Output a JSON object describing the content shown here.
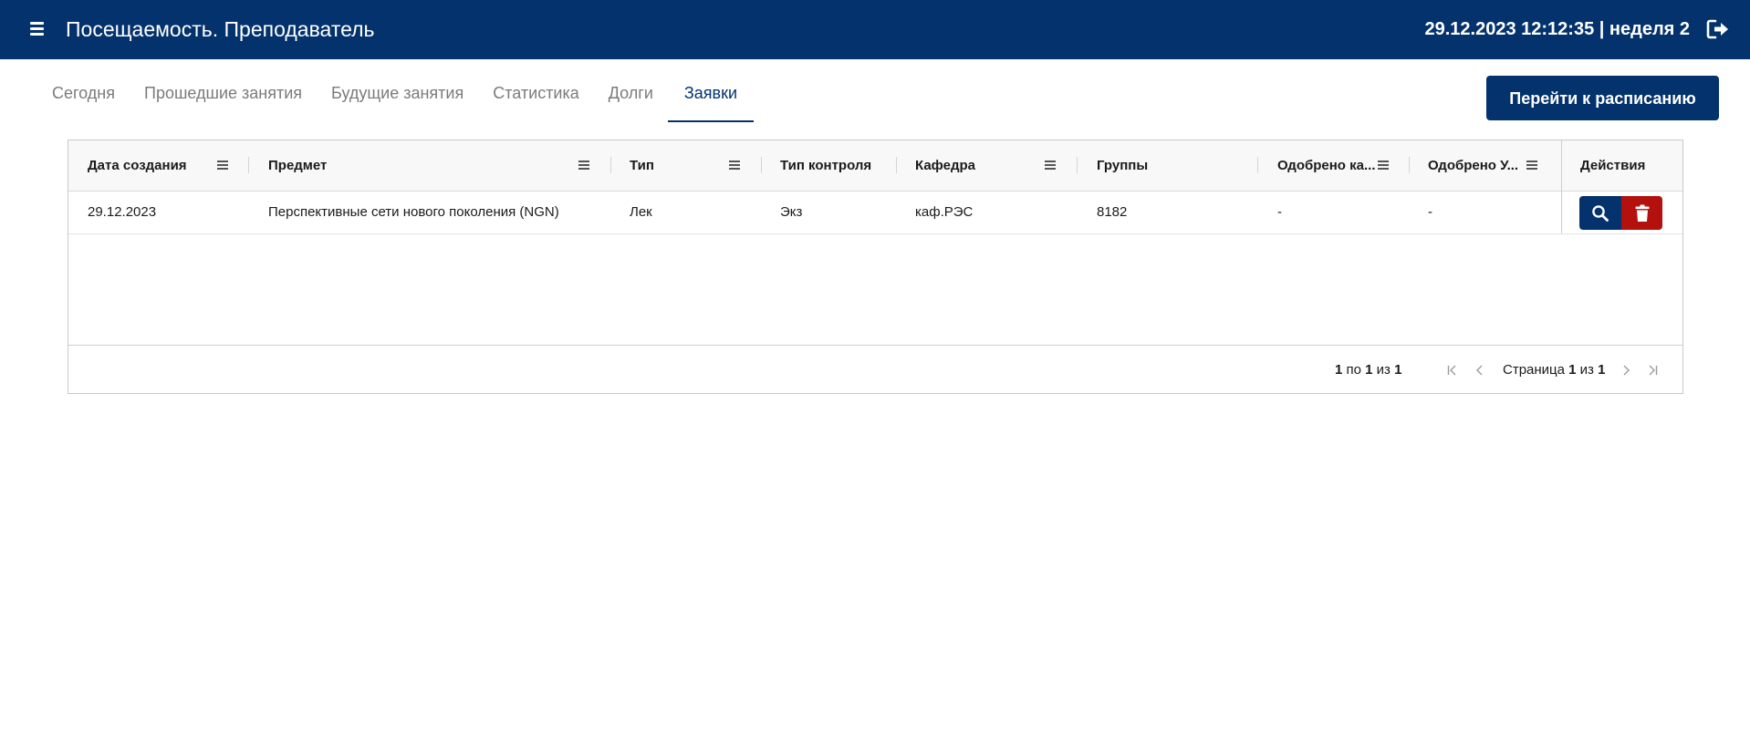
{
  "header": {
    "title": "Посещаемость. Преподаватель",
    "datetime": "29.12.2023 12:12:35 | неделя 2",
    "menu_icon": "hamburger-icon",
    "logout_icon": "logout-icon",
    "background_color": "#03326c"
  },
  "tabs": [
    {
      "label": "Сегодня",
      "active": false
    },
    {
      "label": "Прошедшие занятия",
      "active": false
    },
    {
      "label": "Будущие занятия",
      "active": false
    },
    {
      "label": "Статистика",
      "active": false
    },
    {
      "label": "Долги",
      "active": false
    },
    {
      "label": "Заявки",
      "active": true
    }
  ],
  "schedule_button": {
    "label": "Перейти к расписанию"
  },
  "grid": {
    "columns": [
      "Дата создания",
      "Предмет",
      "Тип",
      "Тип контроля",
      "Кафедра",
      "Группы",
      "Одобрено ка...",
      "Одобрено У...",
      "Действия"
    ],
    "rows": [
      {
        "date": "29.12.2023",
        "subject": "Перспективные сети нового поколения (NGN)",
        "type": "Лек",
        "control_type": "Экз",
        "department": "каф.РЭС",
        "groups": "8182",
        "approved_dept": "-",
        "approved_u": "-"
      }
    ],
    "actions": {
      "view_icon": "search-icon",
      "delete_icon": "trash-icon",
      "view_color": "#03326c",
      "delete_color": "#b3100e"
    }
  },
  "pagination": {
    "range_from": "1",
    "range_to": "1",
    "range_total": "1",
    "range_to_word": "по",
    "range_of_word": "из",
    "page_word": "Страница",
    "page_current": "1",
    "page_of_word": "из",
    "page_total": "1"
  }
}
